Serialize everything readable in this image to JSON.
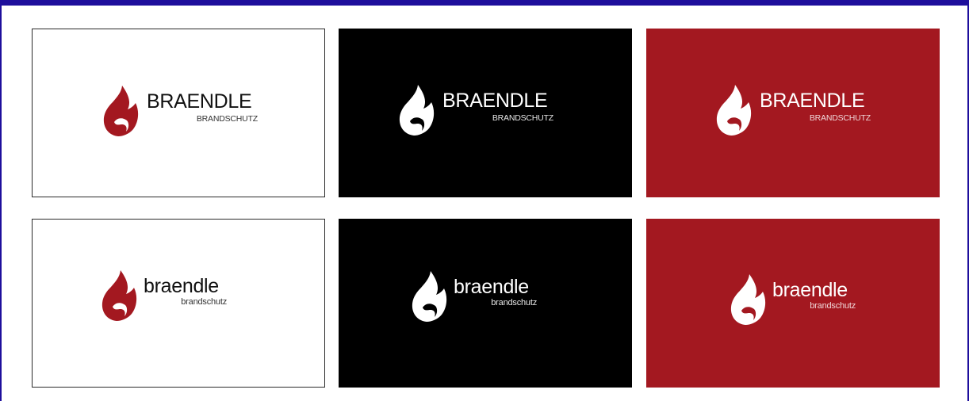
{
  "brand": {
    "upper_name": "BRAENDLE",
    "upper_sub": "BRANDSCHUTZ",
    "lower_name": "braendle",
    "lower_sub": "brandschutz"
  },
  "colors": {
    "frame": "#1e0f9c",
    "brand_red": "#a31820",
    "black": "#000000",
    "white": "#ffffff"
  },
  "icons": {
    "logo_mark": "flame-icon"
  },
  "cards": [
    {
      "row": 1,
      "variant": "uppercase",
      "background": "white"
    },
    {
      "row": 1,
      "variant": "uppercase",
      "background": "black"
    },
    {
      "row": 1,
      "variant": "uppercase",
      "background": "red"
    },
    {
      "row": 2,
      "variant": "lowercase",
      "background": "white"
    },
    {
      "row": 2,
      "variant": "lowercase",
      "background": "black"
    },
    {
      "row": 2,
      "variant": "lowercase",
      "background": "red"
    }
  ]
}
